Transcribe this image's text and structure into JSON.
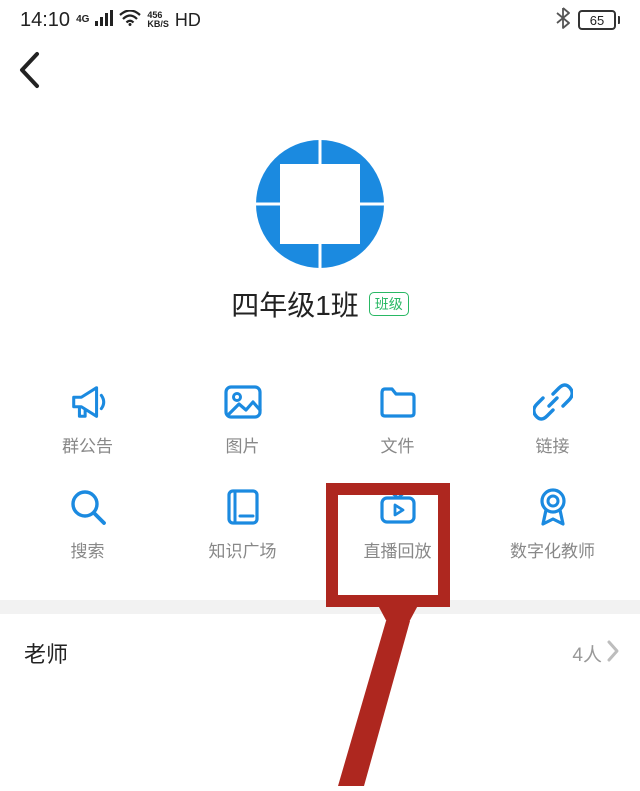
{
  "status": {
    "time": "14:10",
    "net_mode": "4G",
    "speed_top": "456",
    "speed_bottom": "KB/S",
    "hd": "HD",
    "battery": "65"
  },
  "group": {
    "name": "四年级1班",
    "badge": "班级"
  },
  "features": [
    {
      "label": "群公告",
      "name": "announce"
    },
    {
      "label": "图片",
      "name": "pictures"
    },
    {
      "label": "文件",
      "name": "files"
    },
    {
      "label": "链接",
      "name": "links"
    },
    {
      "label": "搜索",
      "name": "search"
    },
    {
      "label": "知识广场",
      "name": "knowledge"
    },
    {
      "label": "直播回放",
      "name": "live-playback"
    },
    {
      "label": "数字化教师",
      "name": "digital-teacher"
    }
  ],
  "rows": {
    "teacher_label": "老师",
    "teacher_count": "4人"
  }
}
